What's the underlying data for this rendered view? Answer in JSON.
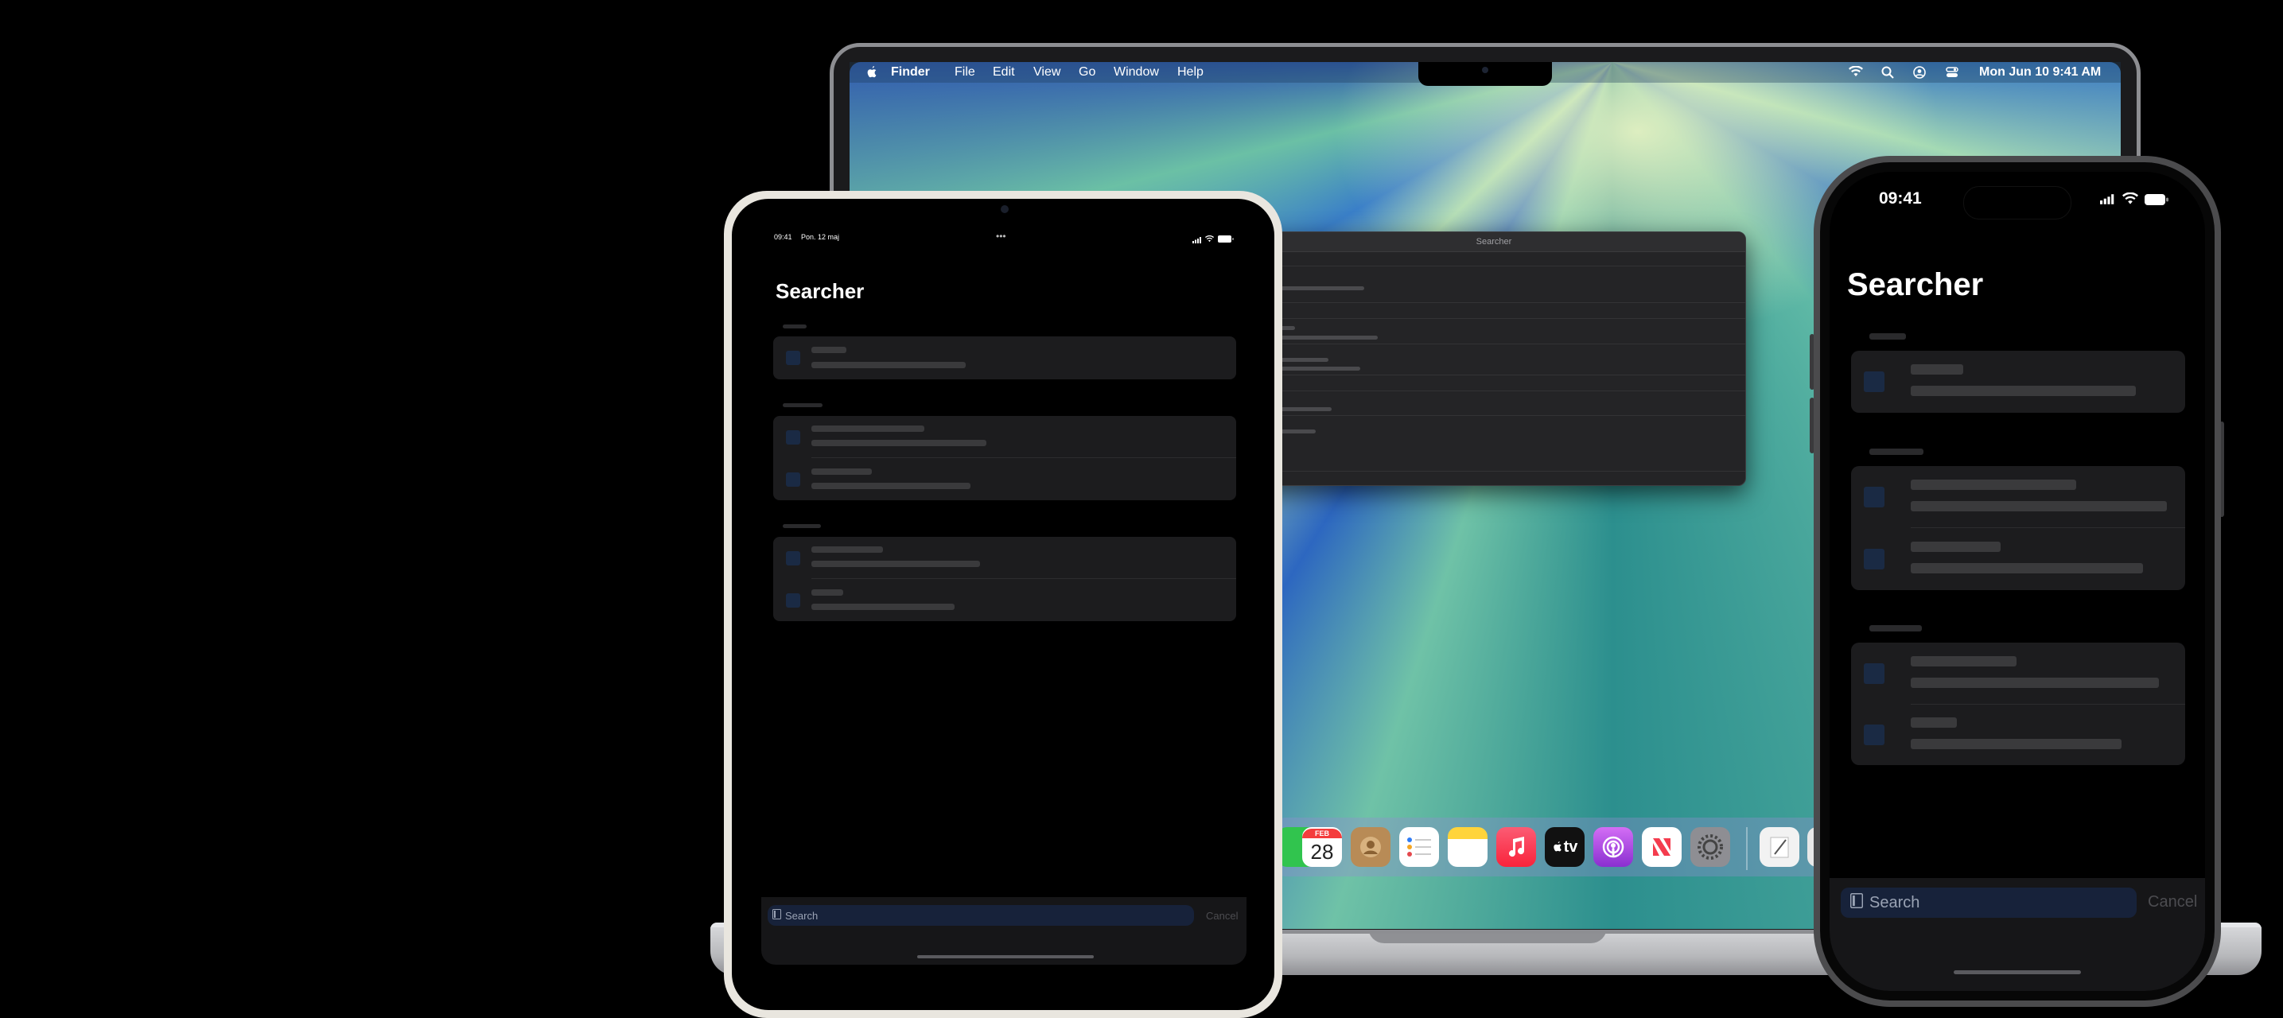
{
  "mac": {
    "menubar": {
      "apple": "",
      "items": [
        "Finder",
        "File",
        "Edit",
        "View",
        "Go",
        "Window",
        "Help"
      ],
      "datetime": "Mon Jun 10  9:41 AM"
    },
    "window_title": "Searcher",
    "dock": {
      "calendar_month": "FEB",
      "calendar_day": "28",
      "tv_label": "tv"
    }
  },
  "ipad": {
    "status_time": "09:41",
    "status_date": "Pon. 12 maj",
    "title": "Searcher",
    "search_placeholder": "Search",
    "cancel_label": "Cancel"
  },
  "iphone": {
    "status_time": "09:41",
    "title": "Searcher",
    "search_placeholder": "Search",
    "cancel_label": "Cancel"
  }
}
